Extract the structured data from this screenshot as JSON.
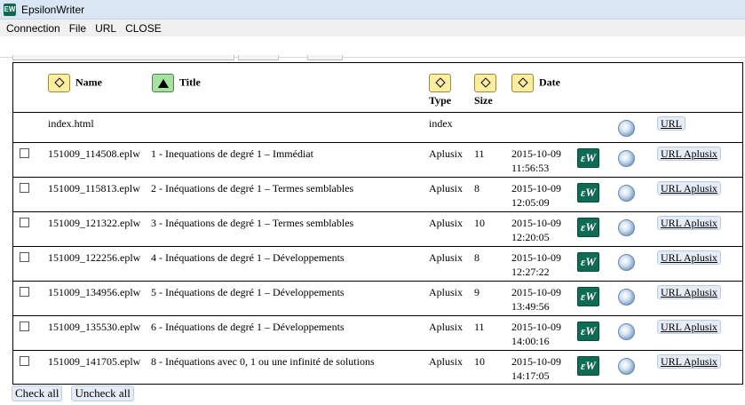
{
  "window": {
    "title": "EpsilonWriter",
    "icon_label": "EW"
  },
  "menu": [
    "Connection",
    "File",
    "URL",
    "CLOSE"
  ],
  "table": {
    "headers": {
      "name": "Name",
      "title": "Title",
      "type": "Type",
      "size": "Size",
      "date": "Date"
    },
    "index_row": {
      "name": "index.html",
      "type": "index",
      "url_label": "URL"
    },
    "rows": [
      {
        "name": "151009_114508.eplw",
        "title": "1 - Inequations de degré 1  –  Immédiat",
        "type": "Aplusix",
        "size": "11",
        "date": "2015-10-09",
        "time": "11:56:53",
        "url_label": "URL Aplusix"
      },
      {
        "name": "151009_115813.eplw",
        "title": "2 - Inéquations de degré 1  –  Termes semblables",
        "type": "Aplusix",
        "size": "8",
        "date": "2015-10-09",
        "time": "12:05:09",
        "url_label": "URL Aplusix"
      },
      {
        "name": "151009_121322.eplw",
        "title": "3 - Inéquations de degré 1  –  Termes semblables",
        "type": "Aplusix",
        "size": "10",
        "date": "2015-10-09",
        "time": "12:20:05",
        "url_label": "URL Aplusix"
      },
      {
        "name": "151009_122256.eplw",
        "title": "4 - Inéquations de degré 1  –  Développements",
        "type": "Aplusix",
        "size": "8",
        "date": "2015-10-09",
        "time": "12:27:22",
        "url_label": "URL Aplusix"
      },
      {
        "name": "151009_134956.eplw",
        "title": "5 - Inéquations de degré 1  –  Développements",
        "type": "Aplusix",
        "size": "9",
        "date": "2015-10-09",
        "time": "13:49:56",
        "url_label": "URL Aplusix"
      },
      {
        "name": "151009_135530.eplw",
        "title": "6 - Inéquations de degré 1  –  Développements",
        "type": "Aplusix",
        "size": "11",
        "date": "2015-10-09",
        "time": "14:00:16",
        "url_label": "URL Aplusix"
      },
      {
        "name": "151009_141705.eplw",
        "title": "8 - Inéquations avec 0, 1 ou une infinité de solutions",
        "type": "Aplusix",
        "size": "10",
        "date": "2015-10-09",
        "time": "14:17:05",
        "url_label": "URL Aplusix"
      }
    ]
  },
  "buttons": {
    "check_all": "Check all",
    "uncheck_all": "Uncheck all"
  },
  "icons": {
    "sort_inactive": "diamond-sort-icon",
    "sort_active": "triangle-up-sort-icon",
    "row_app": "epsilonwriter-icon",
    "row_globe": "globe-icon"
  },
  "colors": {
    "sort_inactive": "#fbeea0",
    "sort_active": "#a6e0a2",
    "ew_green": "#0f6b53",
    "link_bg": "#e5ecf6"
  }
}
